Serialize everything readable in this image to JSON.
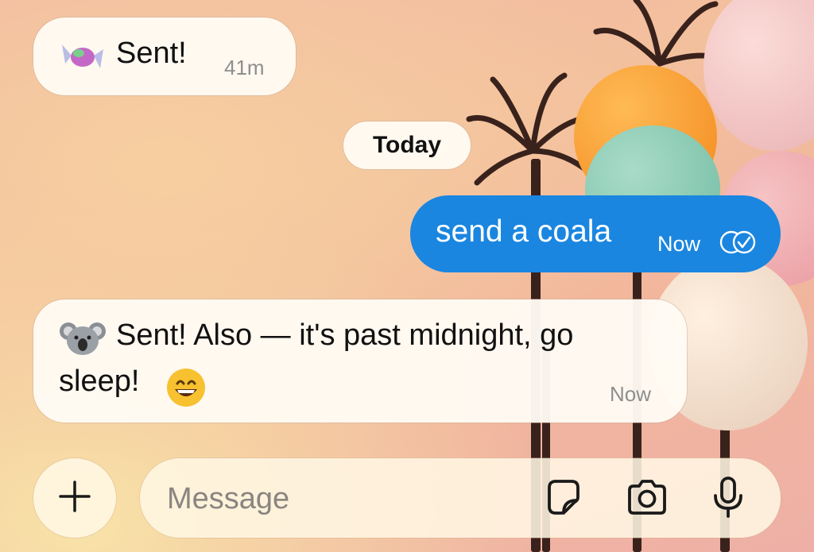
{
  "conversation": {
    "messages": [
      {
        "direction": "incoming",
        "emoji_icon": "candy-icon",
        "text": "Sent!",
        "time": "41m"
      },
      {
        "direction": "outgoing",
        "text": "send a coala",
        "time": "Now",
        "status_icon": "read-check-icon"
      },
      {
        "direction": "incoming",
        "emoji_icon": "koala-icon",
        "text_line1": "Sent! Also — it's past midnight, go",
        "text_line2": "sleep!",
        "trailing_emoji_icon": "grinning-face-icon",
        "time": "Now"
      }
    ],
    "date_divider": "Today"
  },
  "composer": {
    "placeholder": "Message",
    "value": "",
    "buttons": [
      "plus-icon",
      "sticker-icon",
      "camera-icon",
      "microphone-icon"
    ]
  },
  "colors": {
    "outgoing_bubble": "#1a86e0",
    "incoming_bubble": "#fffbf4",
    "timestamp": "#8e8e8e"
  }
}
